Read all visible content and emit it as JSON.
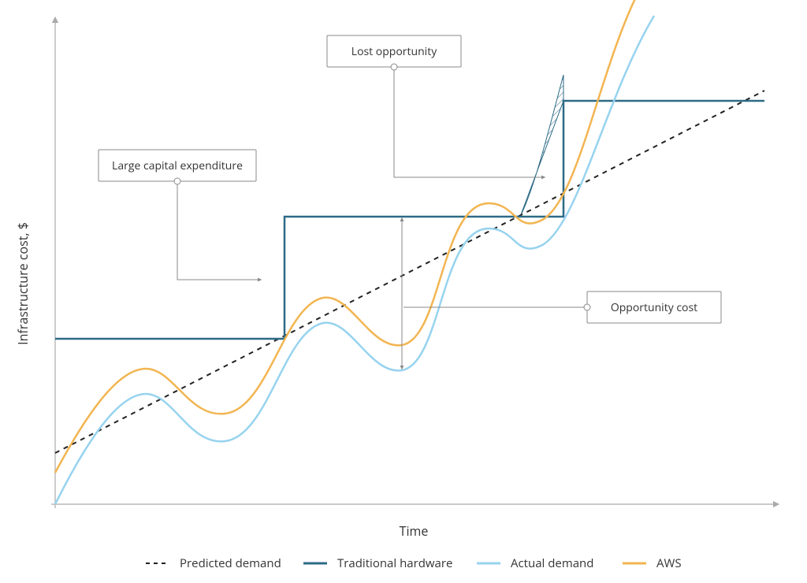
{
  "chart_data": {
    "type": "line",
    "title": "",
    "xlabel": "Time",
    "ylabel": "Infrastructure cost, $",
    "xlim": [
      0,
      100
    ],
    "ylim": [
      0,
      100
    ],
    "grid": false,
    "legend_position": "bottom",
    "series": [
      {
        "name": "Predicted demand",
        "style": "dashed",
        "color": "#222222",
        "x": [
          0,
          100
        ],
        "y": [
          12,
          88
        ]
      },
      {
        "name": "Traditional hardware",
        "style": "step",
        "color": "#2d6a86",
        "x": [
          0,
          32,
          32,
          70,
          70,
          100
        ],
        "y": [
          38,
          38,
          60,
          60,
          84,
          84
        ]
      },
      {
        "name": "Actual demand",
        "style": "curve",
        "color": "#97d3ef",
        "x": [
          0,
          6,
          12,
          18,
          24,
          30,
          36,
          42,
          48,
          54,
          60,
          66,
          72,
          80,
          90
        ],
        "y": [
          0,
          14,
          23,
          18,
          10,
          14,
          32,
          40,
          30,
          40,
          62,
          58,
          62,
          92,
          110
        ]
      },
      {
        "name": "AWS",
        "style": "curve",
        "color": "#f2b551",
        "x": [
          0,
          6,
          12,
          18,
          24,
          30,
          36,
          42,
          48,
          54,
          60,
          66,
          72,
          80,
          90
        ],
        "y": [
          8,
          20,
          29,
          24,
          16,
          20,
          38,
          46,
          36,
          46,
          68,
          64,
          68,
          98,
          116
        ]
      }
    ],
    "annotations": [
      {
        "label": "Large capital expenditure",
        "target_series": "Traditional hardware",
        "target_x": 32
      },
      {
        "label": "Lost opportunity",
        "target": "area where demand exceeds traditional capacity"
      },
      {
        "label": "Opportunity cost",
        "target": "gap between traditional hardware and actual demand"
      }
    ]
  },
  "axes": {
    "x": "Time",
    "y": "Infrastructure cost, $"
  },
  "legend": {
    "predicted": "Predicted demand",
    "traditional": "Traditional hardware",
    "actual": "Actual demand",
    "aws": "AWS"
  },
  "callouts": {
    "capex": "Large capital expenditure",
    "lost": "Lost opportunity",
    "oppcost": "Opportunity cost"
  }
}
